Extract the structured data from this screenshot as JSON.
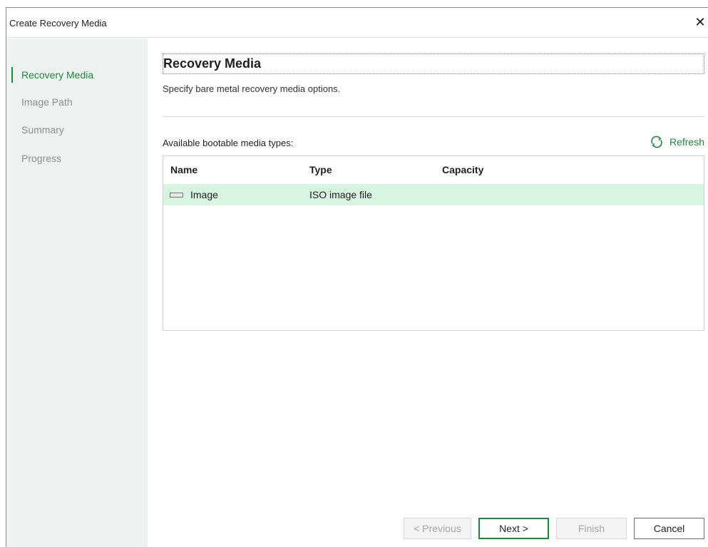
{
  "window": {
    "title": "Create Recovery Media",
    "close_glyph": "✕"
  },
  "sidebar": {
    "items": [
      {
        "label": "Recovery Media",
        "active": true
      },
      {
        "label": "Image Path",
        "active": false
      },
      {
        "label": "Summary",
        "active": false
      },
      {
        "label": "Progress",
        "active": false
      }
    ]
  },
  "main": {
    "title": "Recovery Media",
    "subtitle": "Specify bare metal recovery media options.",
    "media_label": "Available bootable media types:",
    "refresh_label": "Refresh",
    "table": {
      "columns": [
        "Name",
        "Type",
        "Capacity"
      ],
      "rows": [
        {
          "name": "Image",
          "type": "ISO image file",
          "capacity": "",
          "icon": "drive-icon",
          "selected": true
        }
      ]
    }
  },
  "buttons": {
    "previous": "< Previous",
    "next": "Next >",
    "finish": "Finish",
    "cancel": "Cancel"
  },
  "colors": {
    "accent": "#1c8a3a",
    "selected_row": "#d8f5e1",
    "sidebar_bg": "#eef2f1"
  }
}
